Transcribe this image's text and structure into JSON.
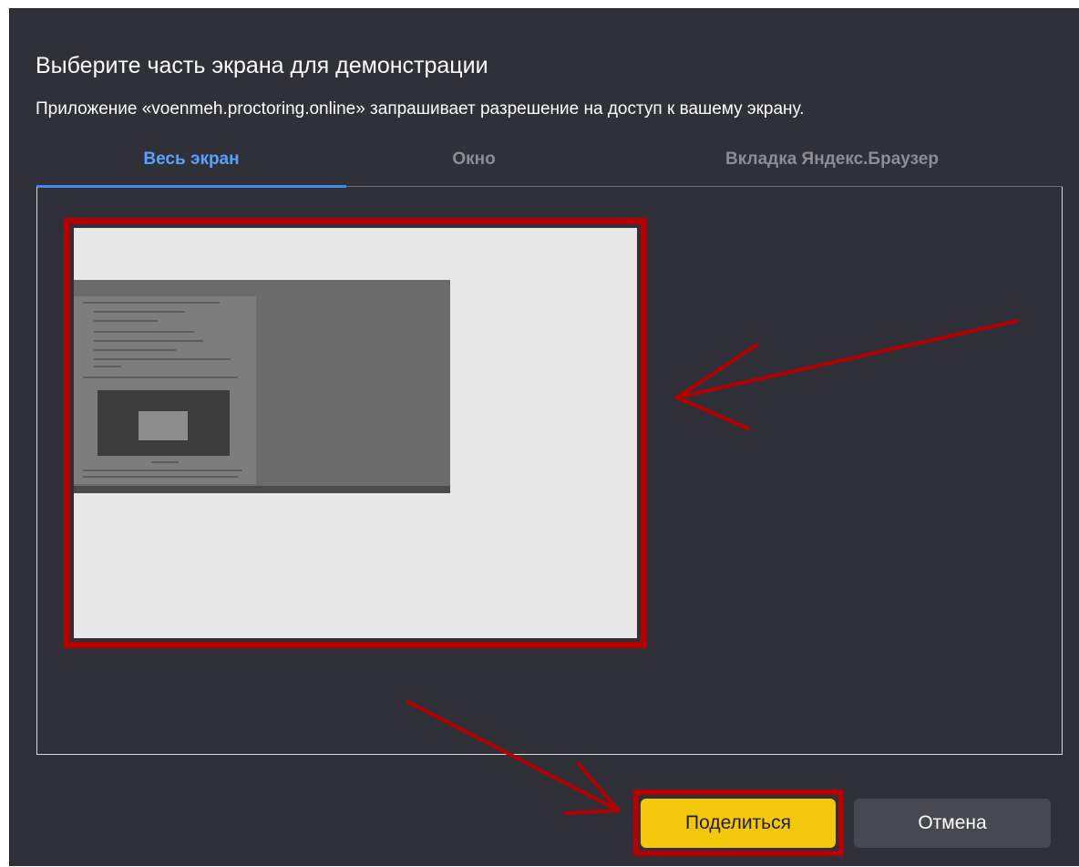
{
  "dialog": {
    "title": "Выберите часть экрана для демонстрации",
    "subtitle": "Приложение «voenmeh.proctoring.online» запрашивает разрешение на доступ к вашему экрану."
  },
  "tabs": [
    {
      "label": "Весь экран",
      "active": true
    },
    {
      "label": "Окно",
      "active": false
    },
    {
      "label": "Вкладка Яндекс.Браузер",
      "active": false
    }
  ],
  "buttons": {
    "share_label": "Поделиться",
    "cancel_label": "Отмена"
  },
  "colors": {
    "dialog_bg": "#2f3038",
    "active_tab": "#3d8bf2",
    "share_button": "#f3c80c",
    "cancel_button": "#484950",
    "annotation_red": "#b40000"
  }
}
